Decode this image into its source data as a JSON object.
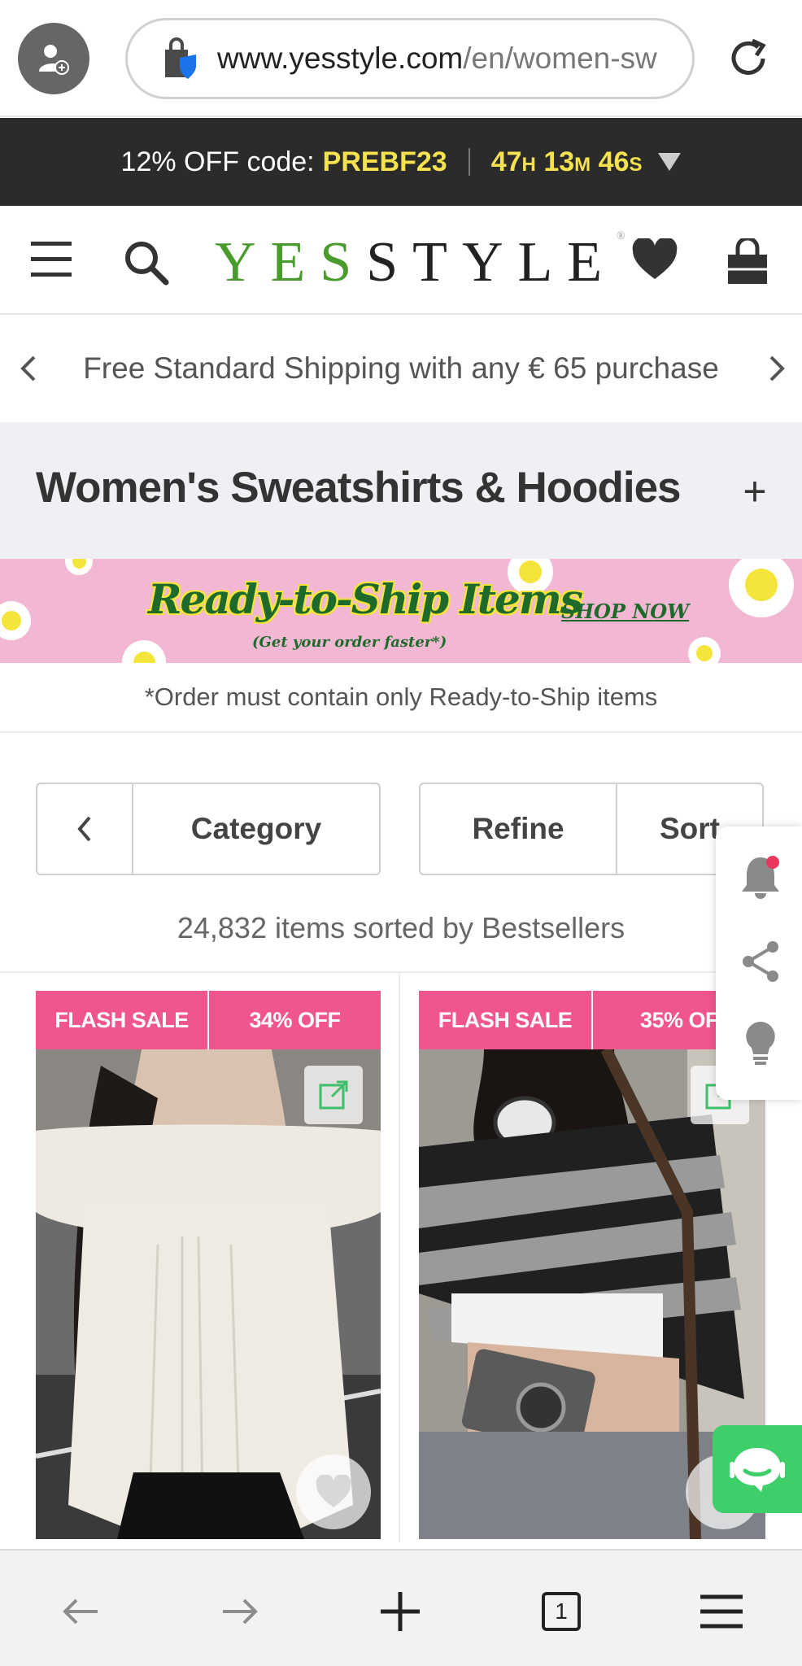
{
  "browser": {
    "url_host": "www.yesstyle.com",
    "url_path": "/en/women-sw"
  },
  "promo": {
    "offer_label": "12% OFF code:",
    "code": "PREBF23",
    "timer_h": "47",
    "timer_h_unit": "H",
    "timer_m": "13",
    "timer_m_unit": "M",
    "timer_s": "46",
    "timer_s_unit": "S"
  },
  "header": {
    "logo_yes": "YES",
    "logo_style": "STYLE",
    "logo_mark": "®"
  },
  "shipping": {
    "message": "Free Standard Shipping with any € 65 purchase"
  },
  "category": {
    "title": "Women's Sweatshirts & Hoodies",
    "expand_label": "+"
  },
  "banner": {
    "title": "Ready-to-Ship Items",
    "subtitle": "(Get your order faster*)",
    "cta": "SHOP NOW",
    "note": "*Order must contain only Ready-to-Ship items"
  },
  "filters": {
    "category_label": "Category",
    "refine_label": "Refine",
    "sort_label": "Sort"
  },
  "results": {
    "summary": "24,832 items sorted by Bestsellers"
  },
  "products": [
    {
      "badge_left": "FLASH SALE",
      "badge_right": "34% OFF"
    },
    {
      "badge_left": "FLASH SALE",
      "badge_right": "35% OF"
    }
  ],
  "bottom_nav": {
    "tab_count": "1"
  },
  "colors": {
    "accent_pink": "#f0558d",
    "brand_green": "#4a9b2e",
    "promo_yellow": "#f6e24f",
    "chat_green": "#3fcf6a"
  }
}
